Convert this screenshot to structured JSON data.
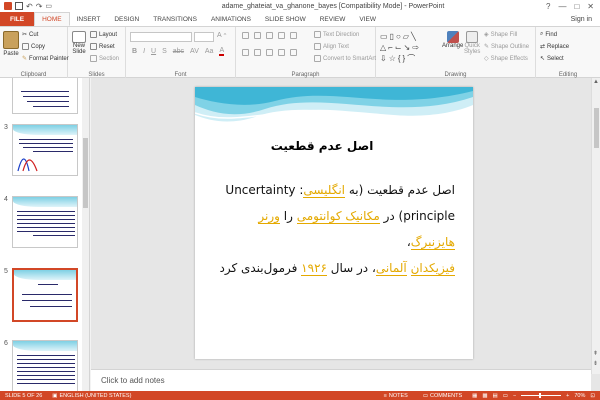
{
  "window": {
    "title": "adame_ghateiat_va_ghanone_bayes [Compatibility Mode] - PowerPoint",
    "controls": [
      "?",
      "—",
      "□",
      "✕"
    ]
  },
  "tabs": {
    "file": "FILE",
    "items": [
      "HOME",
      "INSERT",
      "DESIGN",
      "TRANSITIONS",
      "ANIMATIONS",
      "SLIDE SHOW",
      "REVIEW",
      "VIEW"
    ],
    "active": "HOME",
    "sign_in": "Sign in"
  },
  "ribbon": {
    "clipboard": {
      "paste": "Paste",
      "cut": "Cut",
      "copy": "Copy",
      "format_painter": "Format Painter",
      "label": "Clipboard"
    },
    "slides": {
      "new_slide_1": "New",
      "new_slide_2": "Slide",
      "layout": "Layout",
      "reset": "Reset",
      "section": "Section",
      "label": "Slides"
    },
    "font": {
      "label": "Font"
    },
    "paragraph": {
      "text_direction": "Text Direction",
      "align_text": "Align Text",
      "convert": "Convert to SmartArt",
      "label": "Paragraph"
    },
    "drawing": {
      "arrange": "Arrange",
      "quick_styles_1": "Quick",
      "quick_styles_2": "Styles",
      "shape_fill": "Shape Fill",
      "shape_outline": "Shape Outline",
      "shape_effects": "Shape Effects",
      "label": "Drawing"
    },
    "editing": {
      "find": "Find",
      "replace": "Replace",
      "select": "Select",
      "label": "Editing"
    }
  },
  "thumbnails": [
    {
      "number": "",
      "lines": 7
    },
    {
      "number": "3",
      "lines": 6
    },
    {
      "number": "4",
      "lines": 8
    },
    {
      "number": "5",
      "lines": 4
    },
    {
      "number": "6",
      "lines": 9
    }
  ],
  "slide": {
    "title": "اصل عدم قطعیت",
    "line1_a": "اصل عدم قطعیت (به ",
    "line1_hl": "انگلیسی",
    "line1_b": ": Uncertainty",
    "line2_a": "principle) در ",
    "line2_hl1": "مکانیک کوانتومی",
    "line2_b": " را ",
    "line2_hl2": "ورنر هایزنبرگ",
    "line2_c": "،",
    "line3_hl1": "فیزیکدان",
    "line3_hl2": "آلمانی",
    "line3_a": "، در سال ",
    "line3_hl3": "۱۹۲۶",
    "line3_b": " فرمول‌بندی کرد"
  },
  "notes_placeholder": "Click to add notes",
  "status": {
    "slide_of": "SLIDE 5 OF 26",
    "language": "ENGLISH (UNITED STATES)",
    "notes": "NOTES",
    "comments": "COMMENTS",
    "zoom": "70%"
  },
  "colors": {
    "accent": "#d24726",
    "hyperlink": "#e4a900",
    "slide_wave": "#5cc3dd"
  }
}
